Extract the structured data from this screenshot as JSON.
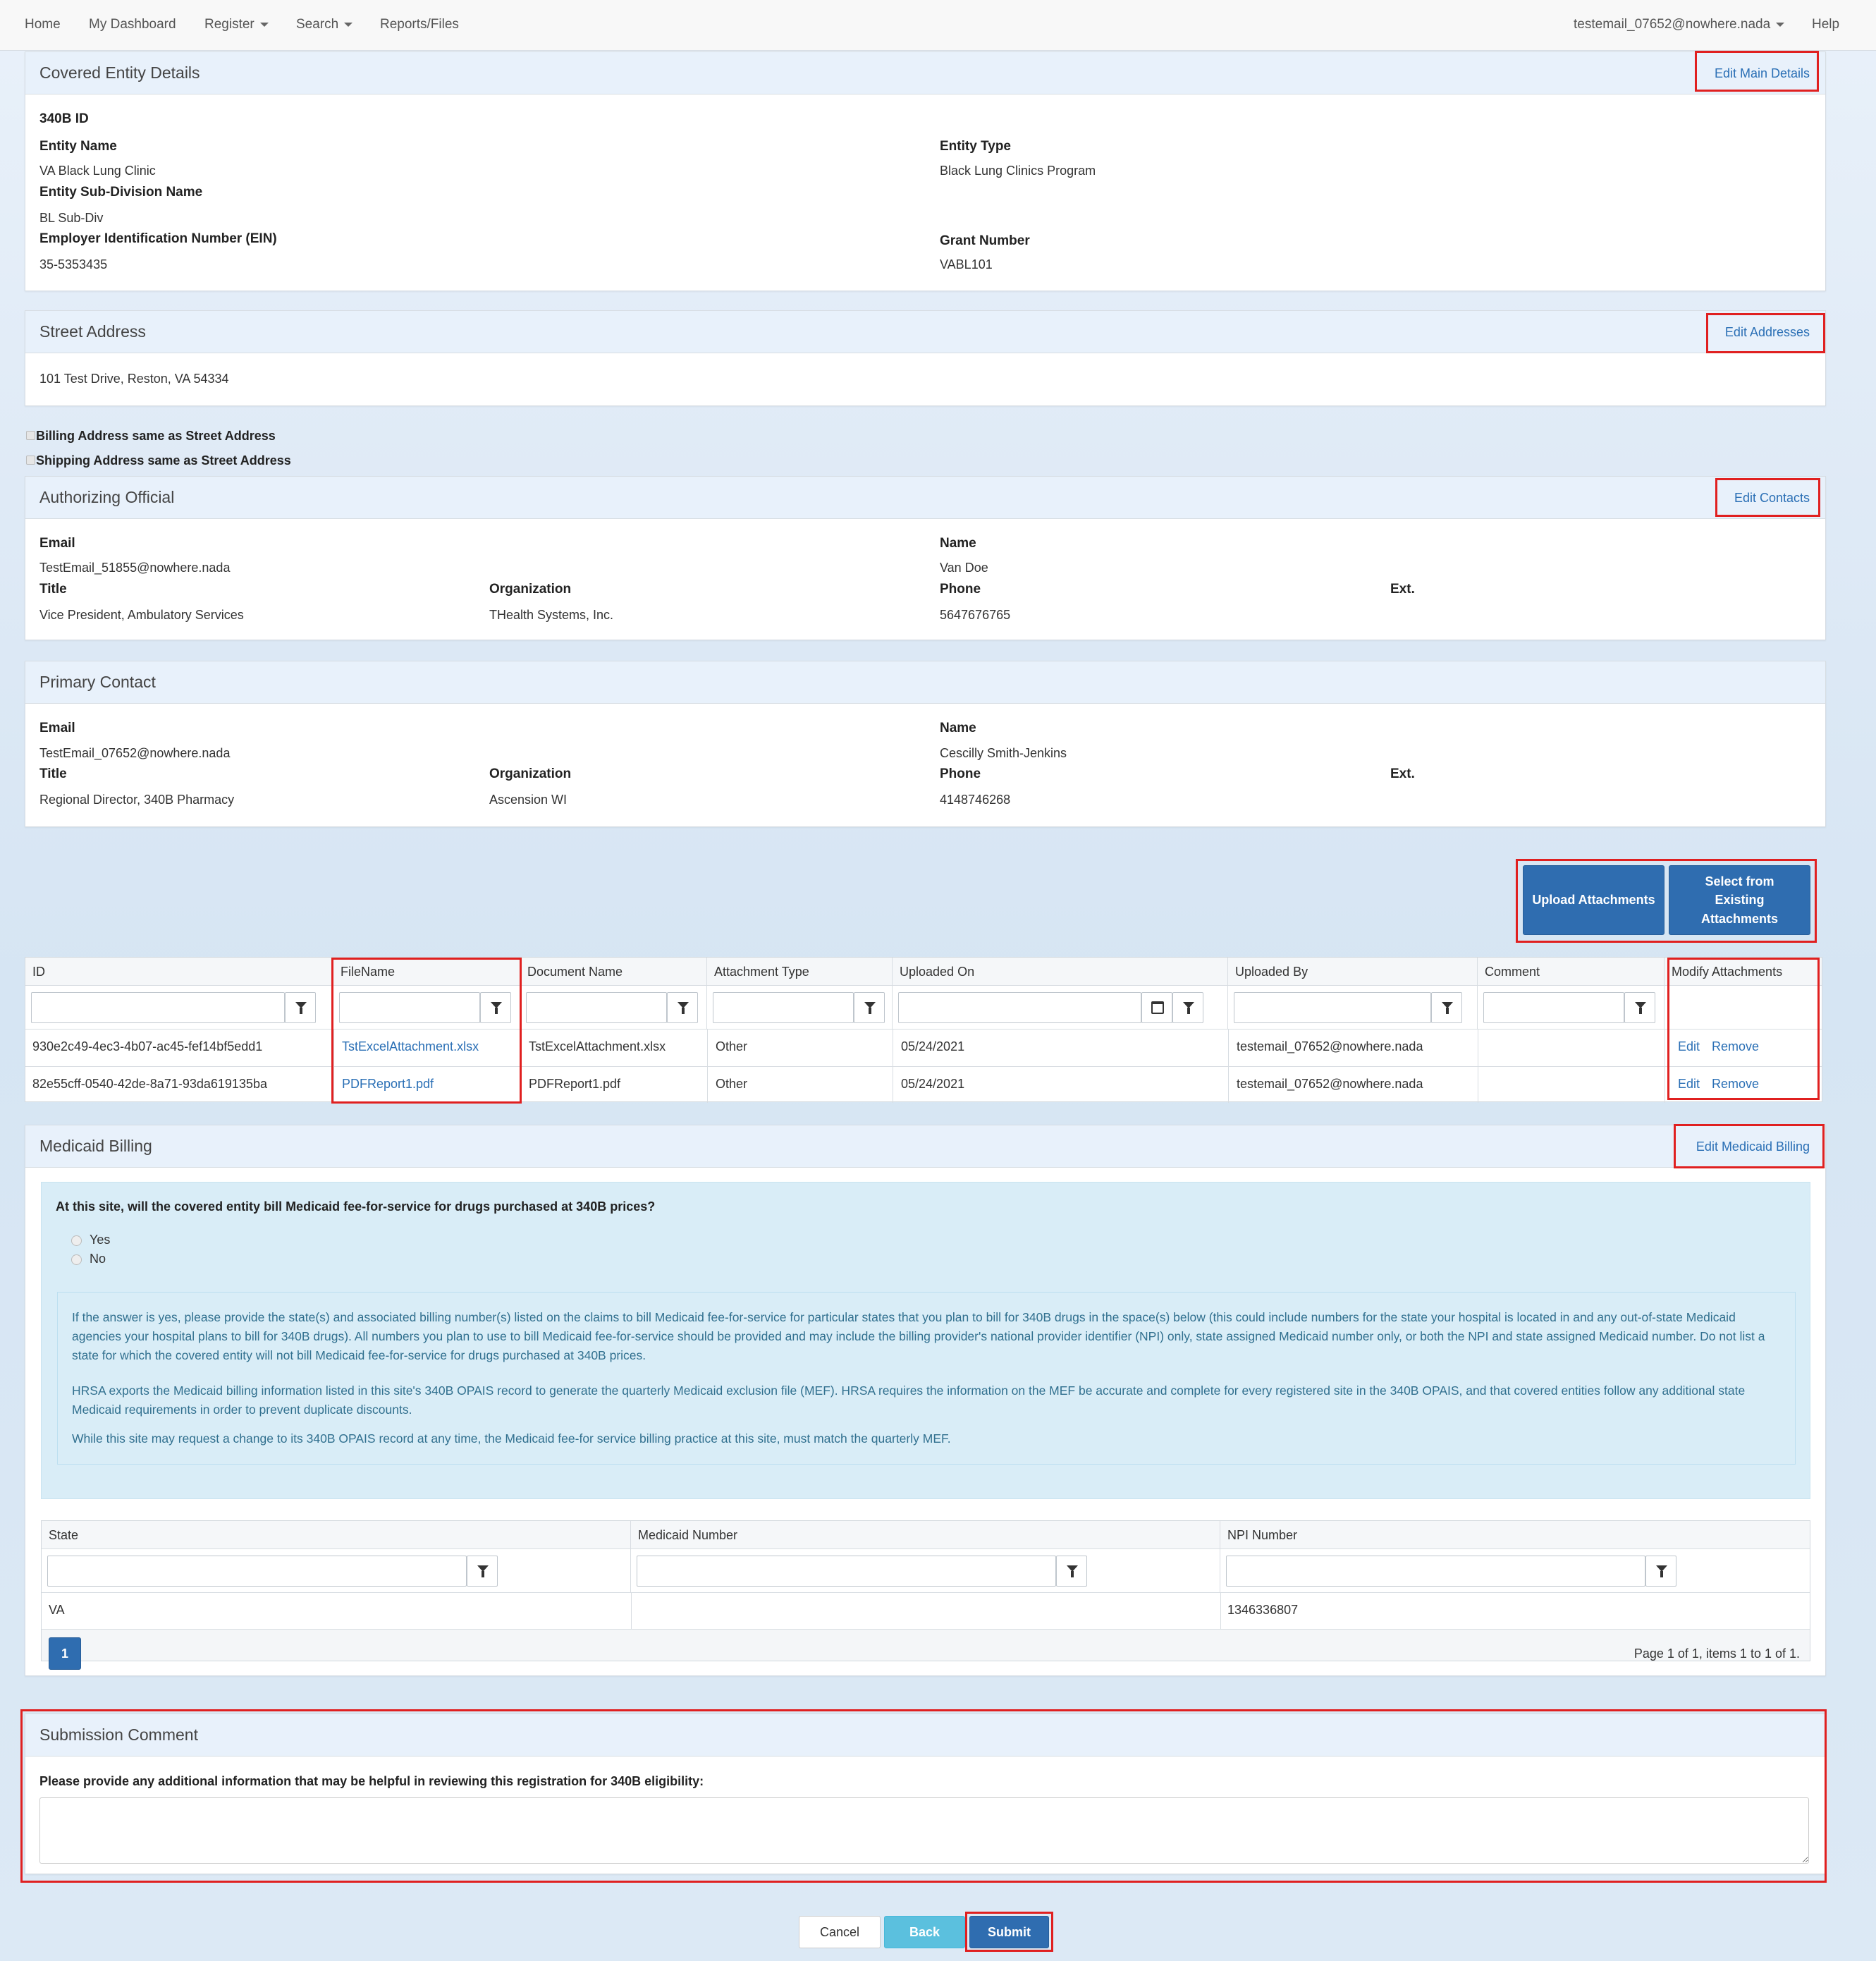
{
  "nav": {
    "home": "Home",
    "dashboard": "My Dashboard",
    "register": "Register",
    "search": "Search",
    "reports": "Reports/Files",
    "user": "testemail_07652@nowhere.nada",
    "help": "Help"
  },
  "covered_entity": {
    "title": "Covered Entity Details",
    "edit": "Edit Main Details",
    "id_label": "340B ID",
    "entity_name_label": "Entity Name",
    "entity_name": "VA Black Lung Clinic",
    "entity_type_label": "Entity Type",
    "entity_type": "Black Lung Clinics Program",
    "subdivision_label": "Entity Sub-Division Name",
    "subdivision": "BL Sub-Div",
    "ein_label": "Employer Identification Number (EIN)",
    "ein": "35-5353435",
    "grant_label": "Grant Number",
    "grant": "VABL101"
  },
  "street_address": {
    "title": "Street Address",
    "edit": "Edit Addresses",
    "address": "101 Test Drive, Reston, VA 54334"
  },
  "checks": {
    "billing": "Billing Address same as Street Address",
    "shipping": "Shipping Address same as Street Address"
  },
  "authorizing": {
    "title": "Authorizing Official",
    "edit": "Edit Contacts",
    "email_label": "Email",
    "email": "TestEmail_51855@nowhere.nada",
    "name_label": "Name",
    "name": "Van Doe",
    "title_label": "Title",
    "title_val": "Vice President, Ambulatory Services",
    "org_label": "Organization",
    "org": "THealth Systems, Inc.",
    "phone_label": "Phone",
    "phone": "5647676765",
    "ext_label": "Ext."
  },
  "primary": {
    "title": "Primary Contact",
    "email_label": "Email",
    "email": "TestEmail_07652@nowhere.nada",
    "name_label": "Name",
    "name": "Cescilly Smith-Jenkins",
    "title_label": "Title",
    "title_val": "Regional Director, 340B Pharmacy",
    "org_label": "Organization",
    "org": "Ascension WI",
    "phone_label": "Phone",
    "phone": "4148746268",
    "ext_label": "Ext."
  },
  "attachments": {
    "upload_btn": "Upload Attachments",
    "select_btn": "Select from Existing Attachments",
    "columns": [
      "ID",
      "FileName",
      "Document Name",
      "Attachment Type",
      "Uploaded On",
      "Uploaded By",
      "Comment",
      "Modify Attachments"
    ],
    "rows": [
      {
        "id": "930e2c49-4ec3-4b07-ac45-fef14bf5edd1",
        "file": "TstExcelAttachment.xlsx",
        "doc": "TstExcelAttachment.xlsx",
        "type": "Other",
        "on": "05/24/2021",
        "by": "testemail_07652@nowhere.nada",
        "comment": "",
        "edit": "Edit",
        "remove": "Remove"
      },
      {
        "id": "82e55cff-0540-42de-8a71-93da619135ba",
        "file": "PDFReport1.pdf",
        "doc": "PDFReport1.pdf",
        "type": "Other",
        "on": "05/24/2021",
        "by": "testemail_07652@nowhere.nada",
        "comment": "",
        "edit": "Edit",
        "remove": "Remove"
      }
    ]
  },
  "medicaid": {
    "title": "Medicaid Billing",
    "edit": "Edit Medicaid Billing",
    "question": "At this site, will the covered entity bill Medicaid fee-for-service for drugs purchased at 340B prices?",
    "yes": "Yes",
    "no": "No",
    "p1": "If the answer is yes, please provide the state(s) and associated billing number(s) listed on the claims to bill Medicaid fee-for-service for particular states that you plan to bill for 340B drugs in the space(s) below (this could include numbers for the state your hospital is located in and any out-of-state Medicaid agencies your hospital plans to bill for 340B drugs). All numbers you plan to use to bill Medicaid fee-for-service should be provided and may include the billing provider's national provider identifier (NPI) only, state assigned Medicaid number only, or both the NPI and state assigned Medicaid number. Do not list a state for which the covered entity will not bill Medicaid fee-for-service for drugs purchased at 340B prices.",
    "p2": "HRSA exports the Medicaid billing information listed in this site's 340B OPAIS record to generate the quarterly Medicaid exclusion file (MEF). HRSA requires the information on the MEF be accurate and complete for every registered site in the 340B OPAIS, and that covered entities follow any additional state Medicaid requirements in order to prevent duplicate discounts.",
    "p3": "While this site may request a change to its 340B OPAIS record at any time, the Medicaid fee-for service billing practice at this site, must match the quarterly MEF.",
    "columns": [
      "State",
      "Medicaid Number",
      "NPI Number"
    ],
    "row": {
      "state": "VA",
      "medicaid": "",
      "npi": "1346336807"
    },
    "page": "1",
    "page_info": "Page 1 of 1, items 1 to 1 of 1."
  },
  "submission": {
    "title": "Submission Comment",
    "prompt": "Please provide any additional information that may be helpful in reviewing this registration for 340B eligibility:",
    "value": ""
  },
  "footer": {
    "cancel": "Cancel",
    "back": "Back",
    "submit": "Submit"
  },
  "colors": {
    "accent": "#2f6db0",
    "info": "#5bc0de",
    "highlight": "#e02020",
    "panel_head": "#e8f1fb"
  }
}
